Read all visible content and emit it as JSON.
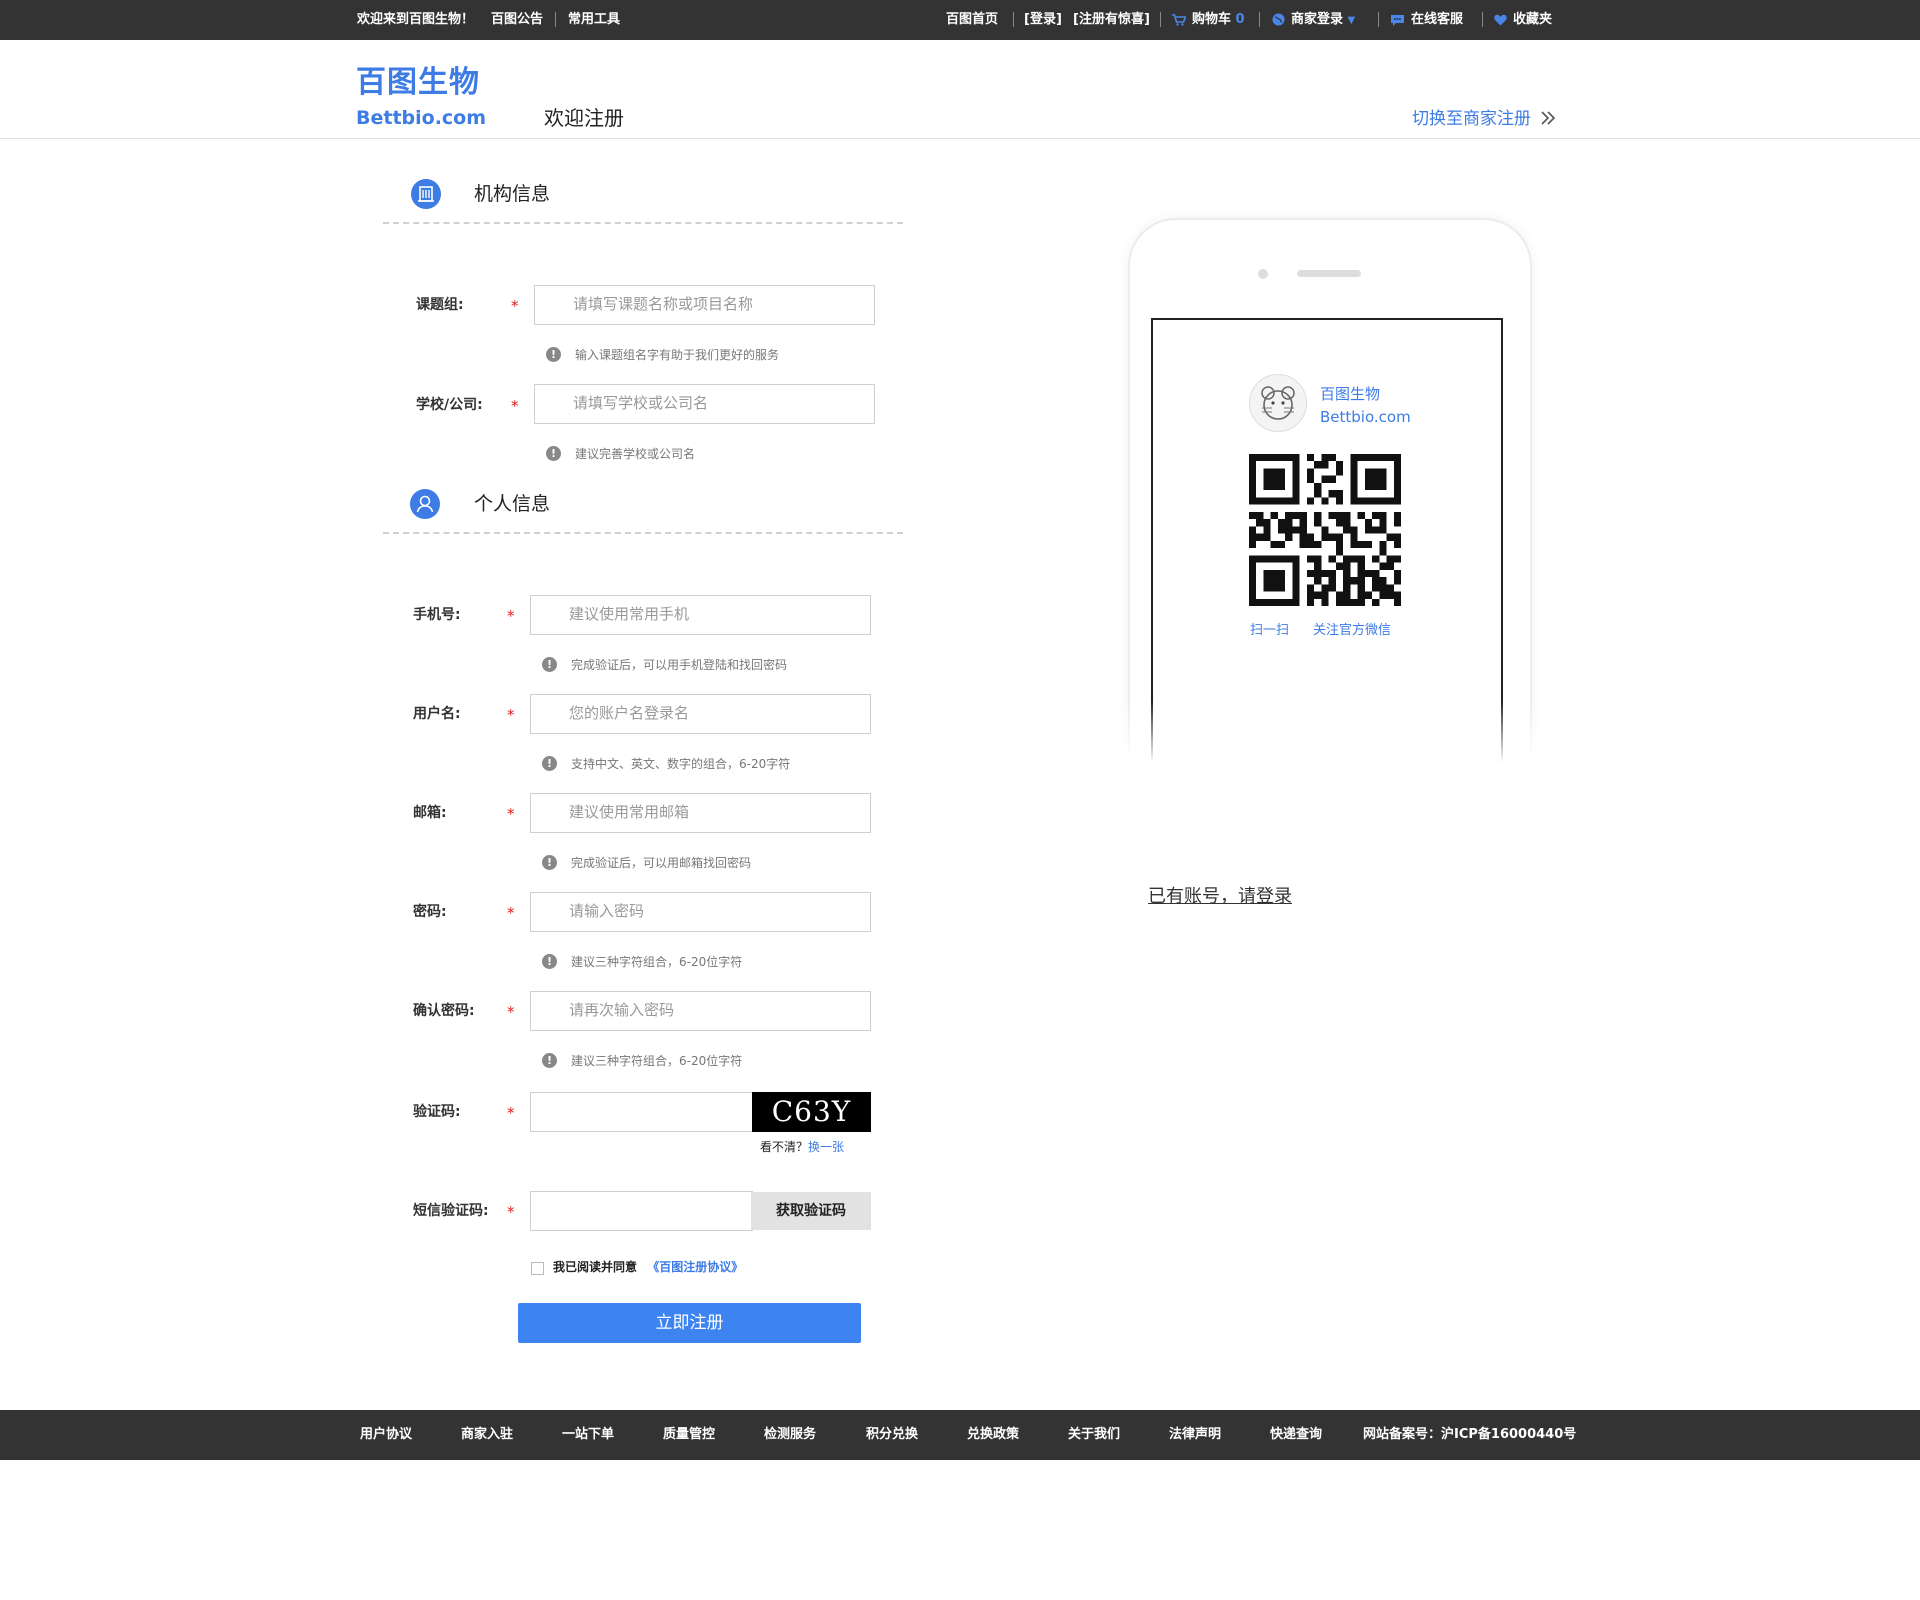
{
  "topbar": {
    "welcome": "欢迎来到百图生物！",
    "announce": "百图公告",
    "tools": "常用工具",
    "home": "百图首页",
    "login": "[登录]",
    "register_gift": "[注册有惊喜]",
    "cart_label": "购物车",
    "cart_count": "0",
    "merchant_login": "商家登录",
    "service": "在线客服",
    "favorites": "收藏夹"
  },
  "header": {
    "logo_cn": "百图生物",
    "logo_en": "Bettbio.com",
    "title": "欢迎注册",
    "switch": "切换至商家注册"
  },
  "sections": {
    "org_title": "机构信息",
    "personal_title": "个人信息"
  },
  "form": {
    "group_label": "课题组:",
    "group_placeholder": "请填写课题名称或项目名称",
    "group_hint": "输入课题组名字有助于我们更好的服务",
    "school_label": "学校/公司:",
    "school_placeholder": "请填写学校或公司名",
    "school_hint": "建议完善学校或公司名",
    "phone_label": "手机号:",
    "phone_placeholder": "建议使用常用手机",
    "phone_hint": "完成验证后，可以用手机登陆和找回密码",
    "user_label": "用户名:",
    "user_placeholder": "您的账户名登录名",
    "user_hint": "支持中文、英文、数字的组合，6-20字符",
    "email_label": "邮箱:",
    "email_placeholder": "建议使用常用邮箱",
    "email_hint": "完成验证后，可以用邮箱找回密码",
    "pwd_label": "密码:",
    "pwd_placeholder": "请输入密码",
    "pwd_hint": "建议三种字符组合，6-20位字符",
    "pwd2_label": "确认密码:",
    "pwd2_placeholder": "请再次输入密码",
    "pwd2_hint": "建议三种字符组合，6-20位字符",
    "captcha_label": "验证码:",
    "captcha_text": "C63Y",
    "captcha_unclear": "看不清？",
    "captcha_refresh": "换一张",
    "sms_label": "短信验证码:",
    "sms_button": "获取验证码",
    "agree_text": "我已阅读并同意",
    "agree_link": "《百图注册协议》",
    "submit": "立即注册",
    "required_mark": "*"
  },
  "phone_card": {
    "brand_cn": "百图生物",
    "brand_en": "Bettbio.com",
    "scan": "扫一扫",
    "follow": "关注官方微信"
  },
  "login_link": "已有账号，请登录",
  "footer": {
    "items": [
      "用户协议",
      "商家入驻",
      "一站下单",
      "质量管控",
      "检测服务",
      "积分兑换",
      "兑换政策",
      "关于我们",
      "法律声明",
      "快递查询"
    ],
    "icp": "网站备案号：沪ICP备16000440号"
  },
  "colors": {
    "accent": "#3d7be5",
    "button": "#3d84f0",
    "bar": "#333333",
    "required": "#e02020"
  }
}
